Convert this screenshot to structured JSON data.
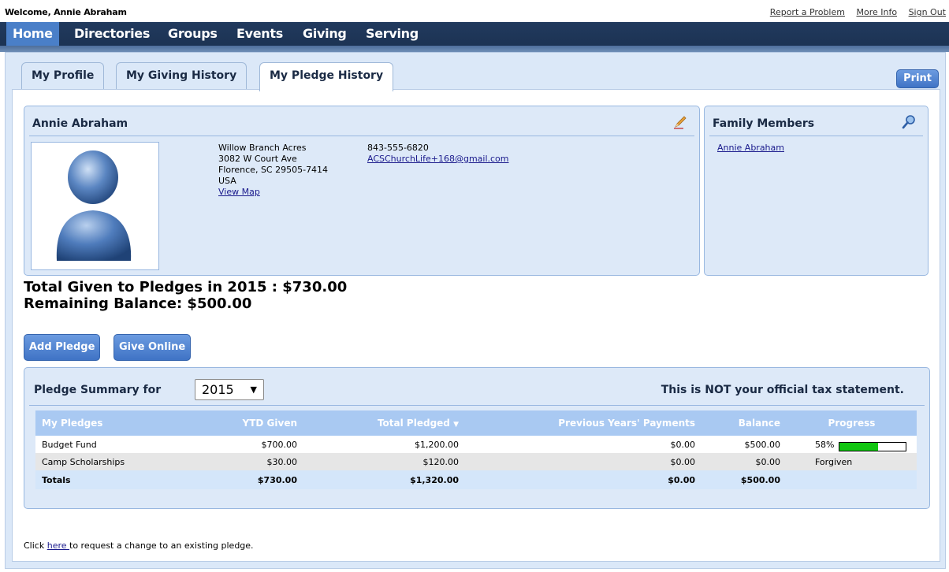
{
  "header": {
    "welcome": "Welcome, Annie Abraham",
    "links": [
      "Report a Problem",
      "More Info",
      "Sign Out"
    ]
  },
  "nav": {
    "items": [
      "Home",
      "Directories",
      "Groups",
      "Events",
      "Giving",
      "Serving"
    ],
    "active": "Home"
  },
  "tabs": [
    "My Profile",
    "My Giving History",
    "My Pledge History"
  ],
  "active_tab": "My Pledge History",
  "print_label": "Print",
  "profile": {
    "name": "Annie Abraham",
    "address": [
      "Willow Branch Acres",
      "3082 W Court Ave",
      "Florence, SC 29505-7414",
      "USA"
    ],
    "view_map": "View Map",
    "phone": "843-555-6820",
    "email": "ACSChurchLife+168@gmail.com",
    "edit_icon": "pencil-icon"
  },
  "family": {
    "title": "Family Members",
    "members": [
      "Annie Abraham"
    ],
    "search_icon": "magnifier-icon"
  },
  "totals": {
    "given_line": "Total Given to Pledges in 2015 : $730.00",
    "balance_line": "Remaining Balance: $500.00"
  },
  "buttons": {
    "add_pledge": "Add Pledge",
    "give_online": "Give Online"
  },
  "summary": {
    "title": "Pledge Summary for",
    "year": "2015",
    "notice": "This is NOT your official tax statement.",
    "columns": [
      "My Pledges",
      "YTD Given",
      "Total Pledged",
      "Previous Years' Payments",
      "Balance",
      "Progress"
    ],
    "sort_indicator": "▼",
    "rows": [
      {
        "name": "Budget Fund",
        "ytd": "$700.00",
        "pledged": "$1,200.00",
        "prev": "$0.00",
        "balance": "$500.00",
        "progress_text": "58%",
        "progress": 0.58
      },
      {
        "name": "Camp Scholarships",
        "ytd": "$30.00",
        "pledged": "$120.00",
        "prev": "$0.00",
        "balance": "$0.00",
        "progress_text": "Forgiven",
        "progress": null
      }
    ],
    "totals": {
      "name": "Totals",
      "ytd": "$730.00",
      "pledged": "$1,320.00",
      "prev": "$0.00",
      "balance": "$500.00"
    }
  },
  "footnote": {
    "before": "Click ",
    "link": "here ",
    "after": "to request a change to an existing pledge."
  },
  "colors": {
    "nav_bg": "#1b3150",
    "nav_active": "#4a7fc8",
    "panel_bg": "#dbe8f8",
    "progress_fill": "#11c611"
  }
}
